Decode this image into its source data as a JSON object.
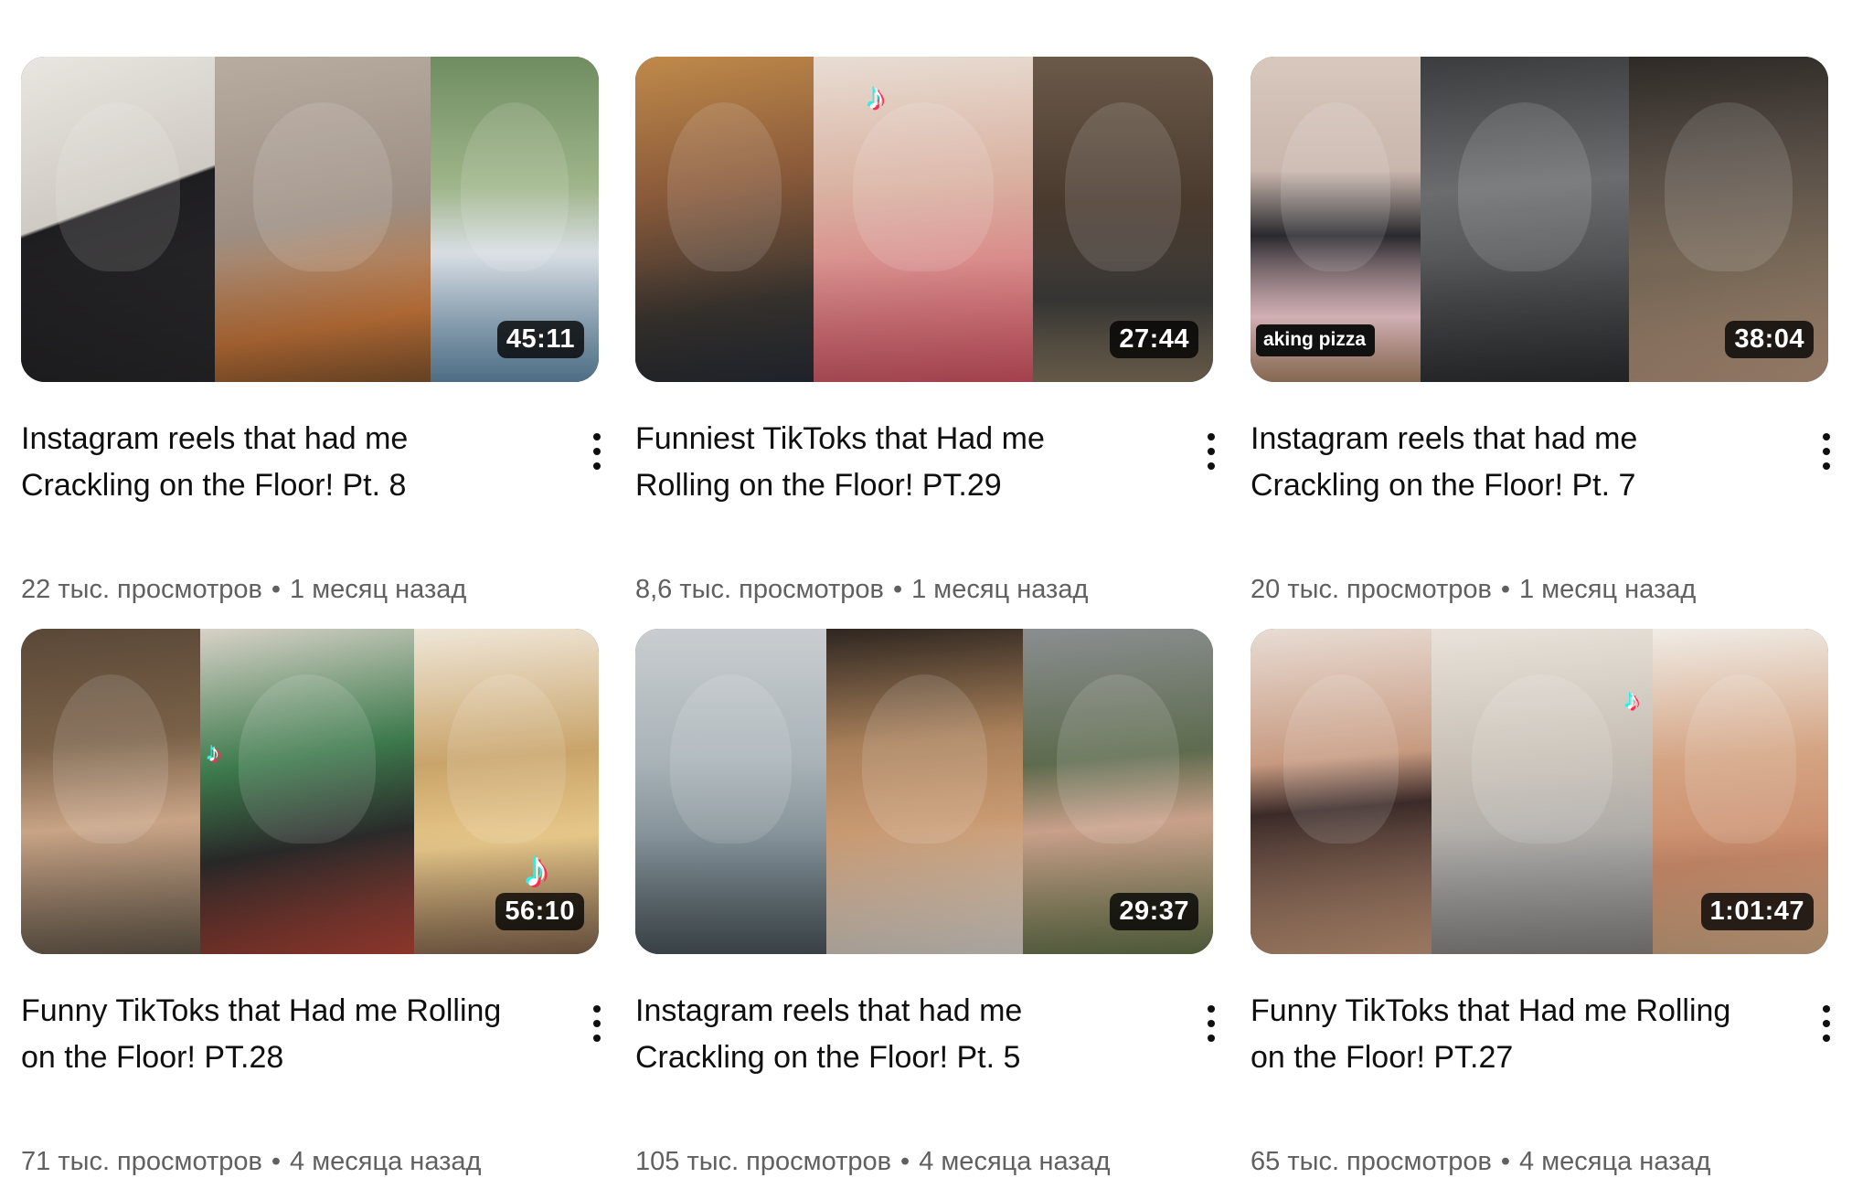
{
  "videos": [
    {
      "title_line1": "Instagram reels that had me",
      "title_line2": "Crackling on the Floor! Pt. 8",
      "duration": "45:11",
      "views": "22 тыс. просмотров",
      "age": "1 месяц назад",
      "separator": "•",
      "thumbnail_colors": [
        "#2b2a2c",
        "#9c8e82",
        "#6f8d61"
      ]
    },
    {
      "title_line1": "Funniest TikToks that Had me",
      "title_line2": "Rolling on the Floor! PT.29",
      "duration": "27:44",
      "views": "8,6 тыс. просмотров",
      "age": "1 месяц назад",
      "separator": "•",
      "thumbnail_colors": [
        "#c08a4a",
        "#d98a8a",
        "#4a3a2e"
      ]
    },
    {
      "title_line1": "Instagram reels that had me",
      "title_line2": "Crackling on the Floor! Pt. 7",
      "duration": "38:04",
      "views": "20 тыс. просмотров",
      "age": "1 месяц назад",
      "separator": "•",
      "overlay_text": "aking pizza",
      "thumbnail_colors": [
        "#c9b6ad",
        "#4a4c4e",
        "#7a6a58"
      ]
    },
    {
      "title_line1": "Funny TikToks that Had me Rolling",
      "title_line2": "on the Floor! PT.28",
      "duration": "56:10",
      "views": "71 тыс. просмотров",
      "age": "4 месяца назад",
      "separator": "•",
      "thumbnail_colors": [
        "#7a6148",
        "#3d7a4c",
        "#c9a46a"
      ]
    },
    {
      "title_line1": "Instagram reels that had me",
      "title_line2": "Crackling on the Floor! Pt. 5",
      "duration": "29:37",
      "views": "105 тыс. просмотров",
      "age": "4 месяца назад",
      "separator": "•",
      "thumbnail_colors": [
        "#7c8a91",
        "#a9805a",
        "#5e6b4e"
      ]
    },
    {
      "title_line1": "Funny TikToks that Had me Rolling",
      "title_line2": "on the Floor! PT.27",
      "duration": "1:01:47",
      "views": "65 тыс. просмотров",
      "age": "4 месяца назад",
      "separator": "•",
      "thumbnail_colors": [
        "#c79a80",
        "#c8c0b6",
        "#d4a483"
      ]
    }
  ]
}
